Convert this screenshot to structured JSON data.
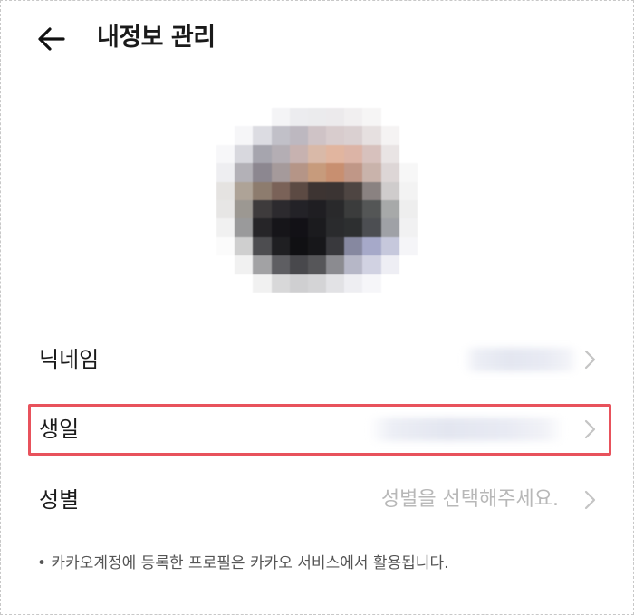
{
  "header": {
    "title": "내정보 관리",
    "back_icon": "arrow-left-icon"
  },
  "profile": {
    "avatar_pixels": [
      [
        "#ffffff",
        "#ffffff",
        "#ffffff",
        "#f4f4f6",
        "#ececef",
        "#ebebed",
        "#eceaec",
        "#f1eff0",
        "#f6f5f5",
        "#ffffff",
        "#ffffff"
      ],
      [
        "#ffffff",
        "#f6f6f8",
        "#dcdce2",
        "#c1c0c8",
        "#bdb8c0",
        "#cfc3c6",
        "#d8cccd",
        "#dad0d1",
        "#e6e0e0",
        "#f5f3f3",
        "#ffffff"
      ],
      [
        "#f7f7f9",
        "#d8d8de",
        "#a6a5ae",
        "#b4aeb4",
        "#c7b2b0",
        "#d9b9a8",
        "#e1b59f",
        "#dcb4a6",
        "#d7c1bd",
        "#e9e4e4",
        "#ffffff"
      ],
      [
        "#eeeef1",
        "#b3b1b7",
        "#8c8790",
        "#a59a9b",
        "#b59587",
        "#c79b7c",
        "#c88f70",
        "#c09787",
        "#c9b3ab",
        "#ddd6d6",
        "#f7f7f7"
      ],
      [
        "#e5e3e1",
        "#aea397",
        "#8d7c6e",
        "#7a6258",
        "#5c4a43",
        "#3d3432",
        "#3b3433",
        "#4e4542",
        "#8a8281",
        "#cfcccc",
        "#f3f3f3"
      ],
      [
        "#e7e6e5",
        "#9c9892",
        "#3e3b3c",
        "#2c2a2e",
        "#232227",
        "#1f1e22",
        "#29292b",
        "#3b3c3c",
        "#545656",
        "#a7a9a9",
        "#eeeeee"
      ],
      [
        "#f1f1f1",
        "#9a9a9b",
        "#262528",
        "#161519",
        "#121116",
        "#1b1b1e",
        "#2a2b2d",
        "#2d2f30",
        "#4c4e52",
        "#9fa1a6",
        "#f1f1f2"
      ],
      [
        "#fbfbfb",
        "#cfcfcf",
        "#4d4d50",
        "#1f1f22",
        "#101013",
        "#17171a",
        "#39393d",
        "#8688a0",
        "#a6a9c9",
        "#c6c8dc",
        "#f5f5f8"
      ],
      [
        "#ffffff",
        "#f1f1f1",
        "#a2a2a4",
        "#5e5e62",
        "#48484c",
        "#565659",
        "#8b8b90",
        "#b6b7c7",
        "#d1d2e2",
        "#eeeef4",
        "#ffffff"
      ],
      [
        "#ffffff",
        "#ffffff",
        "#f1f1f1",
        "#d8d8d9",
        "#cfcfd1",
        "#d4d4d6",
        "#e2e2e5",
        "#eeeef2",
        "#f6f6f9",
        "#ffffff",
        "#ffffff"
      ]
    ]
  },
  "rows": [
    {
      "label": "닉네임",
      "value_hidden": true,
      "chevron_icon": "chevron-right-icon"
    },
    {
      "label": "생일",
      "value_hidden": true,
      "chevron_icon": "chevron-right-icon",
      "highlighted": true
    },
    {
      "label": "성별",
      "placeholder": "성별을 선택해주세요.",
      "chevron_icon": "chevron-right-icon"
    }
  ],
  "note": "• 카카오계정에 등록한 프로필은 카카오 서비스에서 활용됩니다.",
  "colors": {
    "highlight": "#e8525c",
    "placeholder": "#b8b8b8",
    "divider": "#e6e6e6"
  }
}
